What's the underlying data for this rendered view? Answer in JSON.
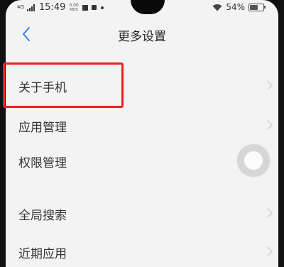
{
  "status_bar": {
    "network": "4G",
    "time": "15:49",
    "speed_value": "0.00",
    "speed_unit": "KB/S",
    "battery_percent": "54%",
    "battery_level": 0.54
  },
  "header": {
    "title": "更多设置"
  },
  "menu": {
    "items": [
      {
        "label": "关于手机"
      },
      {
        "label": "应用管理"
      },
      {
        "label": "权限管理"
      },
      {
        "label": "全局搜索"
      },
      {
        "label": "近期应用"
      }
    ]
  },
  "highlight_color": "#e8231f",
  "accent_color": "#3b7cf0",
  "icons": [
    "back-icon",
    "wifi-icon",
    "battery-icon",
    "chevron-right-icon",
    "floating-ball-icon"
  ]
}
